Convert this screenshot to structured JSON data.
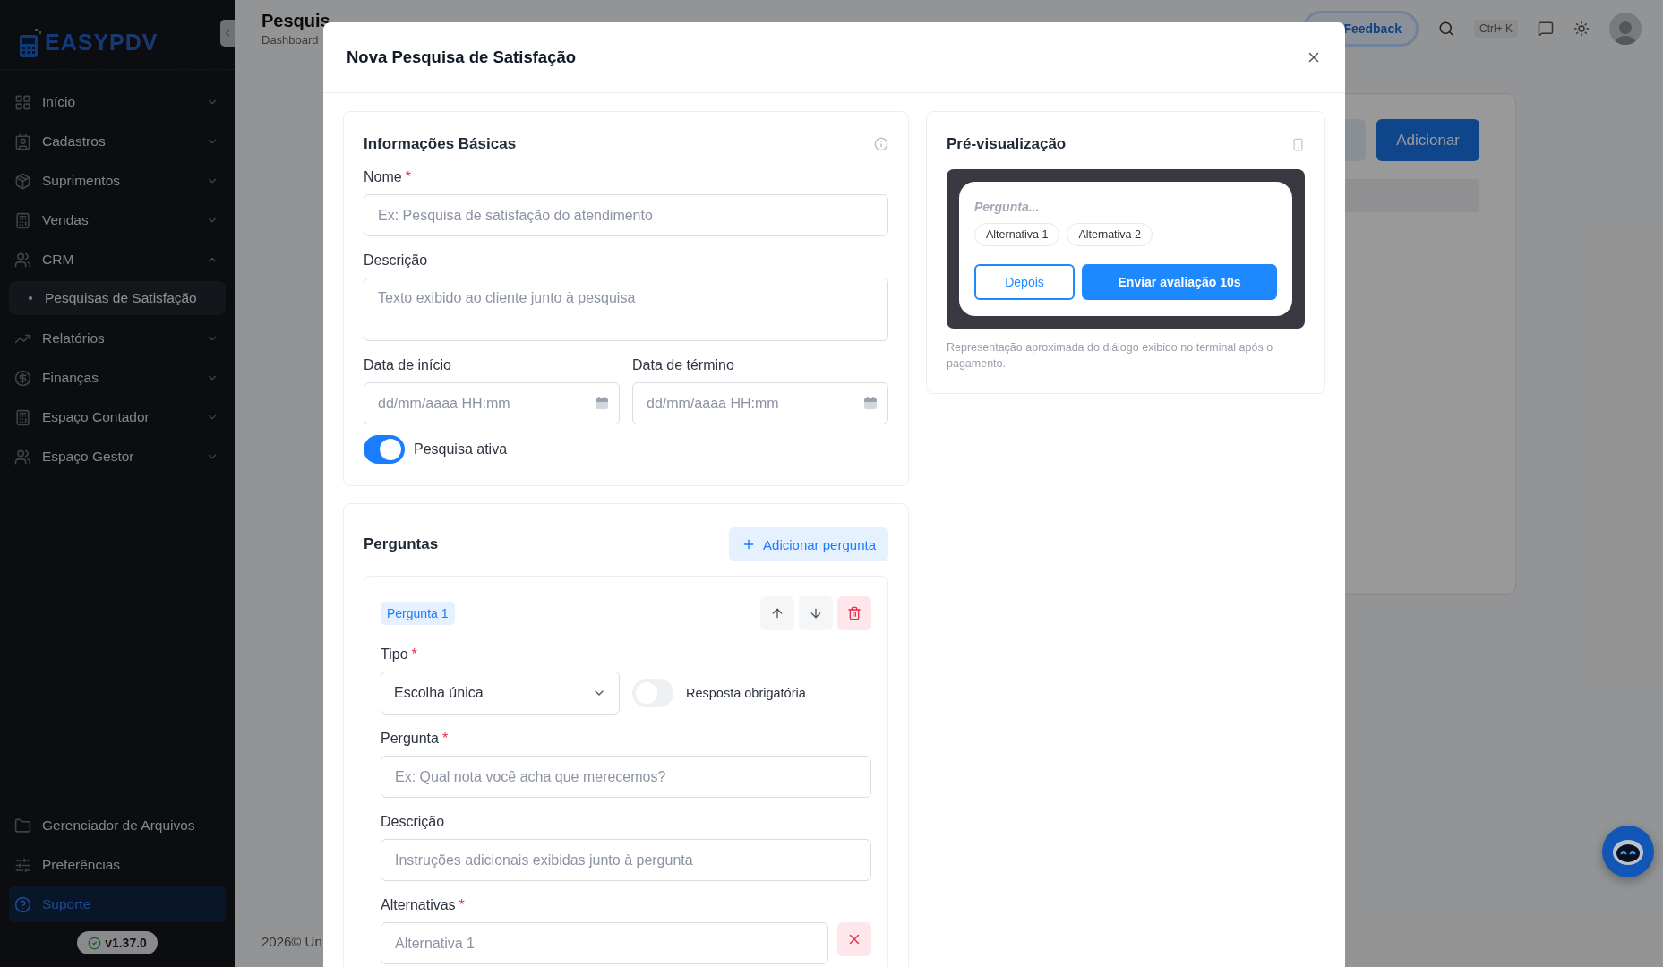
{
  "sidebar": {
    "logo_parts": [
      "EASY",
      "PDV"
    ],
    "items": [
      {
        "label": "Início",
        "expanded": false
      },
      {
        "label": "Cadastros",
        "expanded": false
      },
      {
        "label": "Suprimentos",
        "expanded": false
      },
      {
        "label": "Vendas",
        "expanded": false
      },
      {
        "label": "CRM",
        "expanded": true,
        "children": [
          {
            "label": "Pesquisas de Satisfação",
            "selected": true
          }
        ]
      },
      {
        "label": "Relatórios",
        "expanded": false
      },
      {
        "label": "Finanças",
        "expanded": false
      },
      {
        "label": "Espaço Contador",
        "expanded": false
      },
      {
        "label": "Espaço Gestor",
        "expanded": false
      }
    ],
    "footer_items": [
      {
        "label": "Gerenciador de Arquivos",
        "selected": false
      },
      {
        "label": "Preferências",
        "selected": false
      },
      {
        "label": "Suporte",
        "selected": true
      }
    ],
    "version": "v1.37.0"
  },
  "header": {
    "title": "Pesquis",
    "breadcrumb": "Dashboard",
    "feedback": "Feedback",
    "shortcut": "Ctrl+ K"
  },
  "page": {
    "add_button": "Adicionar",
    "footer": "2026© Un"
  },
  "modal": {
    "title": "Nova Pesquisa de Satisfação",
    "basic_info": {
      "title": "Informações Básicas",
      "name": {
        "label": "Nome",
        "required_mark": "*",
        "placeholder": "Ex: Pesquisa de satisfação do atendimento"
      },
      "description": {
        "label": "Descrição",
        "placeholder": "Texto exibido ao cliente junto à pesquisa"
      },
      "start_date": {
        "label": "Data de início",
        "placeholder": "dd/mm/aaaa HH:mm"
      },
      "end_date": {
        "label": "Data de término",
        "placeholder": "dd/mm/aaaa HH:mm"
      },
      "active": {
        "label": "Pesquisa ativa",
        "on": true
      }
    },
    "questions": {
      "title": "Perguntas",
      "add_button": "Adicionar pergunta",
      "items": [
        {
          "badge": "Pergunta 1",
          "type": {
            "label": "Tipo",
            "required_mark": "*",
            "value": "Escolha única"
          },
          "mandatory": {
            "label": "Resposta obrigatória",
            "on": false
          },
          "question": {
            "label": "Pergunta",
            "required_mark": "*",
            "placeholder": "Ex: Qual nota você acha que merecemos?"
          },
          "description": {
            "label": "Descrição",
            "placeholder": "Instruções adicionais exibidas junto à pergunta"
          },
          "alternatives": {
            "label": "Alternativas",
            "required_mark": "*",
            "items": [
              {
                "placeholder": "Alternativa 1"
              }
            ]
          }
        }
      ]
    },
    "preview": {
      "title": "Pré-visualização",
      "question_placeholder": "Pergunta...",
      "options": [
        "Alternativa 1",
        "Alternativa 2"
      ],
      "later_button": "Depois",
      "submit_button": "Enviar avaliação 10s",
      "note": "Representação aproximada do diálogo exibido no terminal após o pagamento."
    }
  }
}
